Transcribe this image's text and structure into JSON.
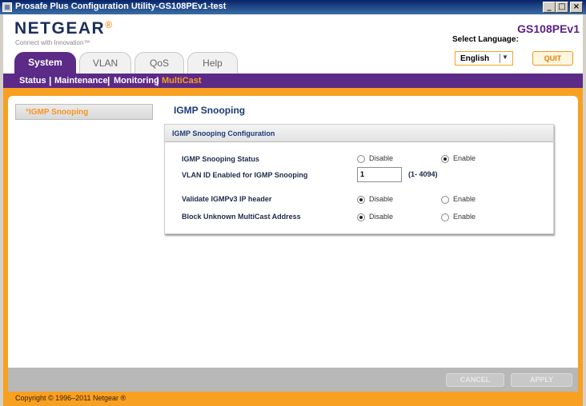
{
  "window": {
    "title": "Prosafe Plus Configuration Utility-GS108PEv1-test",
    "min_glyph": "_",
    "max_glyph": "□",
    "close_glyph": "×"
  },
  "header": {
    "logo": "NETGEAR",
    "logo_mark": "®",
    "tagline": "Connect with Innovation™",
    "model": "GS108PEv1",
    "language_label": "Select Language:",
    "language_value": "English",
    "quit_label": "QUIT"
  },
  "tabs": [
    {
      "label": "System",
      "active": true
    },
    {
      "label": "VLAN",
      "active": false
    },
    {
      "label": "QoS",
      "active": false
    },
    {
      "label": "Help",
      "active": false
    }
  ],
  "subnav": [
    {
      "label": "Status",
      "current": false
    },
    {
      "label": "Maintenance",
      "current": false
    },
    {
      "label": "Monitoring",
      "current": false
    },
    {
      "label": "MultiCast",
      "current": true
    }
  ],
  "sidebar": {
    "items": [
      {
        "label": "°IGMP Snooping",
        "selected": true
      }
    ]
  },
  "page": {
    "title": "IGMP Snooping",
    "panel_title": "IGMP Snooping Configuration",
    "rows": {
      "status": {
        "label": "IGMP Snooping Status",
        "opt1": "Disable",
        "opt2": "Enable",
        "selected": "Enable"
      },
      "vlan": {
        "label": "VLAN ID Enabled for IGMP Snooping",
        "value": "1",
        "range": "(1- 4094)"
      },
      "validate": {
        "label": "Validate IGMPv3 IP header",
        "opt1": "Disable",
        "opt2": "Enable",
        "selected": "Disable"
      },
      "block": {
        "label": "Block Unknown MultiCast Address",
        "opt1": "Disable",
        "opt2": "Enable",
        "selected": "Disable"
      }
    }
  },
  "footer": {
    "cancel_label": "CANCEL",
    "apply_label": "APPLY",
    "copyright": "Copyright © 1996–2011 Netgear ®"
  },
  "colors": {
    "brand_purple": "#5c2a87",
    "accent_orange": "#f7a021"
  }
}
